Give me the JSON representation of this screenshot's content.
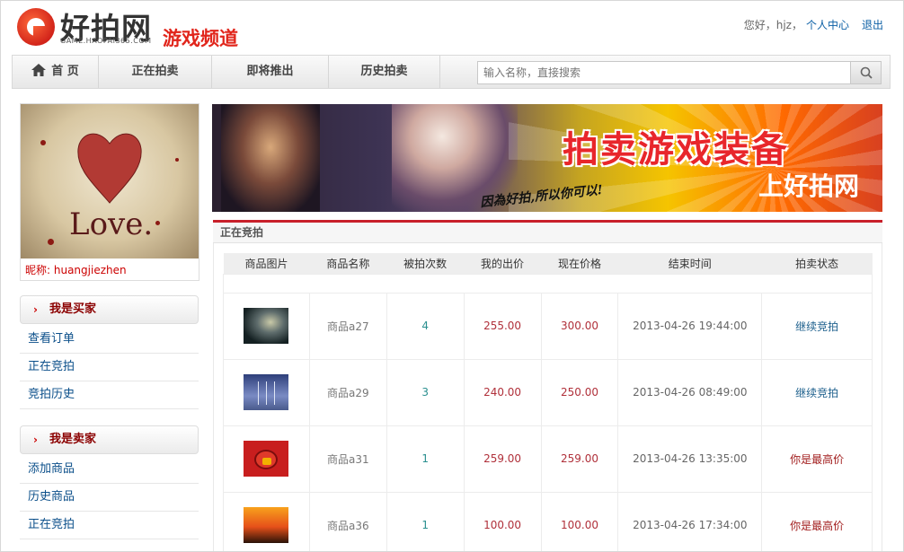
{
  "header": {
    "brand": "好拍网",
    "domain": "GAME.HAOPAI365.COM",
    "channel": "游戏频道",
    "greeting": "您好，hjz，",
    "user_center": "个人中心",
    "logout": "退出"
  },
  "nav": {
    "items": [
      {
        "label": "首 页",
        "icon": "home-icon"
      },
      {
        "label": "正在拍卖"
      },
      {
        "label": "即将推出"
      },
      {
        "label": "历史拍卖"
      }
    ],
    "search_placeholder": "输入名称，直接搜索",
    "search_icon": "search-icon"
  },
  "profile": {
    "avatar_text": "Love.",
    "nick_label": "昵称: ",
    "nick_value": "huangjiezhen"
  },
  "sidebar": {
    "buyer": {
      "title": "我是买家",
      "links": [
        "查看订单",
        "正在竞拍",
        "竞拍历史"
      ]
    },
    "seller": {
      "title": "我是卖家",
      "links": [
        "添加商品",
        "历史商品",
        "正在竞拍"
      ]
    }
  },
  "banner": {
    "title": "拍卖游戏装备",
    "subtitle": "上好拍网",
    "slogan": "因為好拍,所以你可以!"
  },
  "panel": {
    "title": "正在竞拍",
    "columns": [
      "商品图片",
      "商品名称",
      "被拍次数",
      "我的出价",
      "现在价格",
      "结束时间",
      "拍卖状态"
    ],
    "rows": [
      {
        "name": "商品a27",
        "count": "4",
        "my_bid": "255.00",
        "price": "300.00",
        "end": "2013-04-26 19:44:00",
        "status": "继续竞拍",
        "status_color": "#1c5f8c"
      },
      {
        "name": "商品a29",
        "count": "3",
        "my_bid": "240.00",
        "price": "250.00",
        "end": "2013-04-26 08:49:00",
        "status": "继续竞拍",
        "status_color": "#1c5f8c"
      },
      {
        "name": "商品a31",
        "count": "1",
        "my_bid": "259.00",
        "price": "259.00",
        "end": "2013-04-26 13:35:00",
        "status": "你是最高价",
        "status_color": "#a11c1c"
      },
      {
        "name": "商品a36",
        "count": "1",
        "my_bid": "100.00",
        "price": "100.00",
        "end": "2013-04-26 17:34:00",
        "status": "你是最高价",
        "status_color": "#a11c1c"
      }
    ]
  }
}
